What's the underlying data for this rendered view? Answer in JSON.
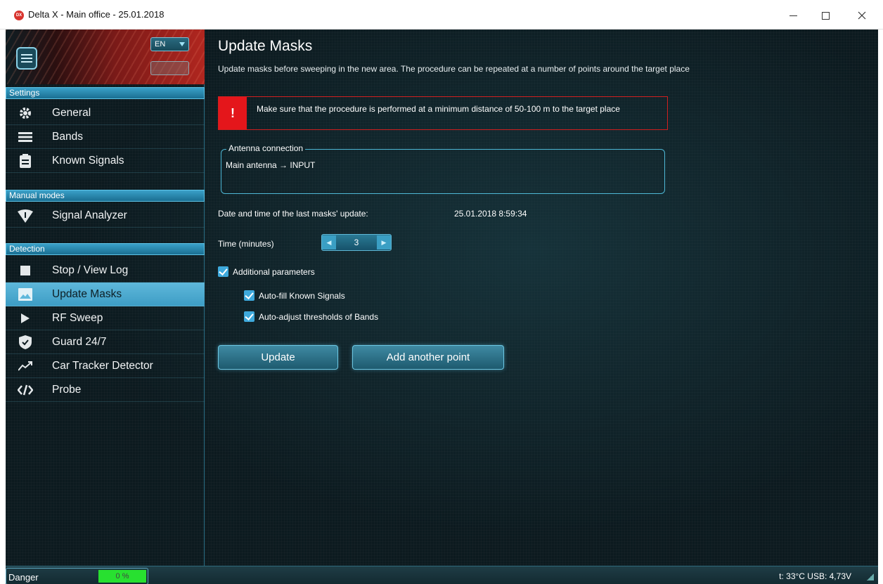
{
  "window": {
    "title": "Delta X - Main office - 25.01.2018",
    "app_icon_text": "DX"
  },
  "sidebar": {
    "language": "EN",
    "sections": [
      {
        "label": "Settings",
        "items": [
          {
            "label": "General",
            "icon": "gear-icon"
          },
          {
            "label": "Bands",
            "icon": "list-icon"
          },
          {
            "label": "Known Signals",
            "icon": "clipboard-icon"
          }
        ]
      },
      {
        "label": "Manual modes",
        "items": [
          {
            "label": "Signal Analyzer",
            "icon": "signal-analyzer-icon"
          }
        ]
      },
      {
        "label": "Detection",
        "items": [
          {
            "label": "Stop / View Log",
            "icon": "stop-icon"
          },
          {
            "label": "Update Masks",
            "icon": "image-icon",
            "active": true
          },
          {
            "label": "RF Sweep",
            "icon": "play-icon"
          },
          {
            "label": "Guard 24/7",
            "icon": "shield-icon"
          },
          {
            "label": "Car Tracker Detector",
            "icon": "trend-icon"
          },
          {
            "label": "Probe",
            "icon": "code-icon"
          }
        ]
      }
    ]
  },
  "main": {
    "title": "Update Masks",
    "subtitle": "Update masks before sweeping in the new area. The procedure can be repeated at a number of points around the target place",
    "warning": {
      "icon_text": "!",
      "text": "Make sure that the procedure is performed at a minimum distance of 50-100 m to the target place"
    },
    "antenna": {
      "legend": "Antenna connection",
      "value": "Main antenna → INPUT"
    },
    "last_update": {
      "label": "Date and time of the last masks' update:",
      "value": "25.01.2018 8:59:34"
    },
    "time": {
      "label": "Time (minutes)",
      "value": "3"
    },
    "additional": {
      "label": "Additional parameters",
      "checked": true
    },
    "autofill": {
      "label": "Auto-fill Known Signals",
      "checked": true
    },
    "autoadjust": {
      "label": "Auto-adjust thresholds of Bands",
      "checked": true
    },
    "buttons": {
      "update": "Update",
      "add_point": "Add another point"
    }
  },
  "status": {
    "danger_label": "Danger",
    "danger_value": "0 %",
    "danger_color": "#28e030",
    "right": "t: 33°C  USB: 4,73V"
  },
  "colors": {
    "accent": "#3d9dc5",
    "warning": "#e4161b",
    "background": "#0c1a1f"
  }
}
